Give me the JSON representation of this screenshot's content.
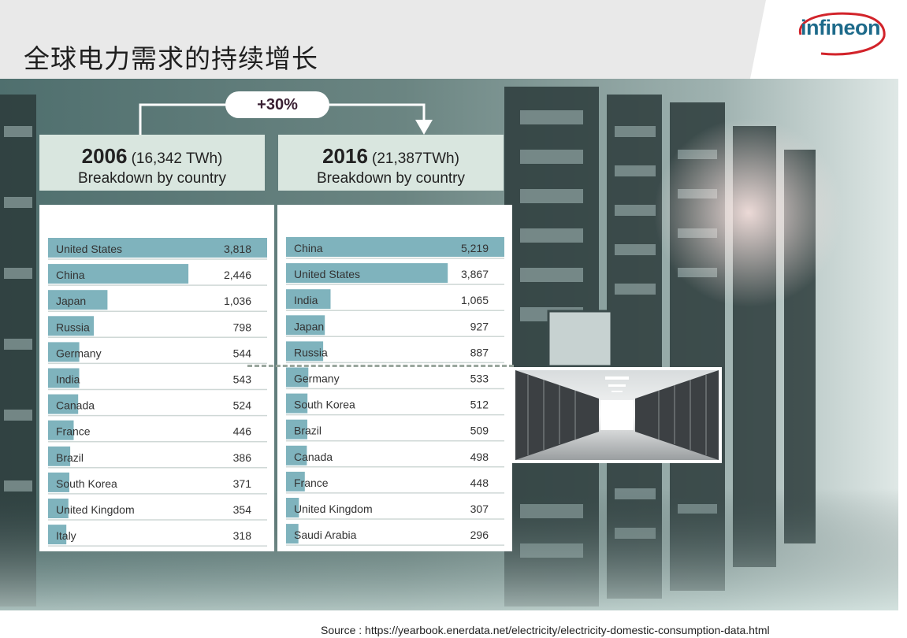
{
  "header": {
    "title": "全球电力需求的持续增长",
    "logo_text": "infineon",
    "brand_color": "#1d6a8a",
    "logo_arc_color": "#d2232a"
  },
  "growth_badge": {
    "label": "+30%"
  },
  "panels": [
    {
      "year": "2006",
      "total": "(16,342 TWh)",
      "subtitle": "Breakdown by country"
    },
    {
      "year": "2016",
      "total": "(21,387TWh)",
      "subtitle": "Breakdown by country"
    }
  ],
  "chart_data": [
    {
      "type": "bar",
      "orientation": "horizontal",
      "title": "2006 (16,342 TWh)",
      "subtitle": "Breakdown by country",
      "categories": [
        "United States",
        "China",
        "Japan",
        "Russia",
        "Germany",
        "India",
        "Canada",
        "France",
        "Brazil",
        "South Korea",
        "United Kingdom",
        "Italy"
      ],
      "values": [
        3818,
        2446,
        1036,
        798,
        544,
        543,
        524,
        446,
        386,
        371,
        354,
        318
      ],
      "value_labels": [
        "3,818",
        "2,446",
        "1,036",
        "798",
        "544",
        "543",
        "524",
        "446",
        "386",
        "371",
        "354",
        "318"
      ],
      "bar_color": "#7fb3bd",
      "xlim": [
        0,
        3818
      ]
    },
    {
      "type": "bar",
      "orientation": "horizontal",
      "title": "2016 (21,387TWh)",
      "subtitle": "Breakdown by country",
      "categories": [
        "China",
        "United States",
        "India",
        "Japan",
        "Russia",
        "Germany",
        "South Korea",
        "Brazil",
        "Canada",
        "France",
        "United Kingdom",
        "Saudi Arabia"
      ],
      "values": [
        5219,
        3867,
        1065,
        927,
        887,
        533,
        512,
        509,
        498,
        448,
        307,
        296
      ],
      "value_labels": [
        "5,219",
        "3,867",
        "1,065",
        "927",
        "887",
        "533",
        "512",
        "509",
        "498",
        "448",
        "307",
        "296"
      ],
      "bar_color": "#7fb3bd",
      "xlim": [
        0,
        5219
      ]
    }
  ],
  "source": {
    "text": "Source : https://yearbook.enerdata.net/electricity/electricity-domestic-consumption-data.html"
  }
}
